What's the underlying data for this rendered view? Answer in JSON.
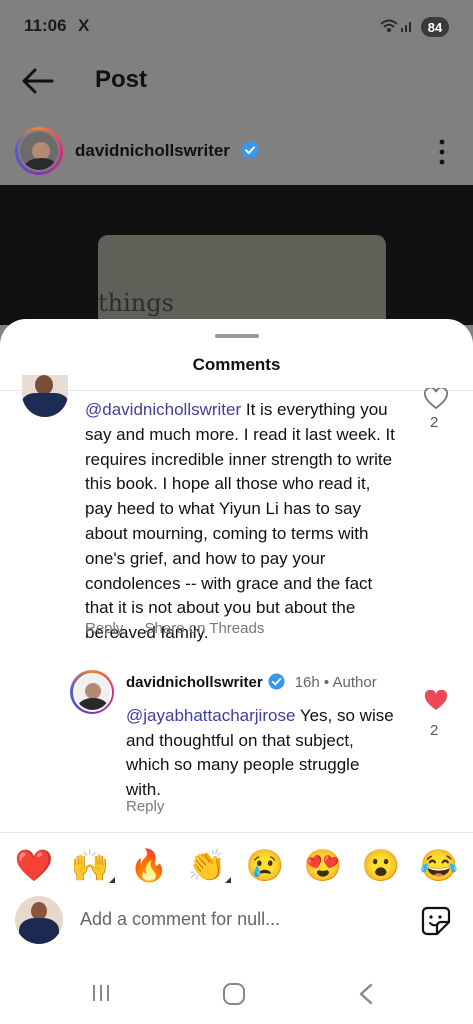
{
  "status_bar": {
    "time": "11:06",
    "x_icon": "X",
    "battery": "84"
  },
  "header": {
    "title": "Post"
  },
  "post": {
    "username": "davidnichollswriter",
    "book_word": "things"
  },
  "comments_sheet": {
    "title": "Comments",
    "comment_1": {
      "mention": "@davidnichollswriter",
      "text": " It is everything you say and much more. I read it last week. It requires incredible inner strength to write this book. I hope all those who read it, pay heed to what Yiyun Li has to say about mourning, coming to terms with one's grief, and how to pay your condolences -- with grace and the fact that it is not about you but about the bereaved family.",
      "likes": "2",
      "reply_label": "Reply",
      "share_label": "Share on Threads"
    },
    "comment_2": {
      "username": "davidnichollswriter",
      "time": "16h",
      "author_label": "• Author",
      "mention": "@jayabhattacharjirose",
      "text": " Yes, so wise and thoughtful on that subject, which so many people struggle with.",
      "likes": "2",
      "reply_label": "Reply"
    }
  },
  "emoji_reactions": [
    "❤️",
    "🙌",
    "🔥",
    "👏",
    "😢",
    "😍",
    "😮",
    "😂"
  ],
  "composer": {
    "placeholder": "Add a comment for null..."
  },
  "colors": {
    "accent_blue": "#3f3f9f",
    "verified_blue": "#3897f0",
    "heart_red": "#ed4956"
  }
}
